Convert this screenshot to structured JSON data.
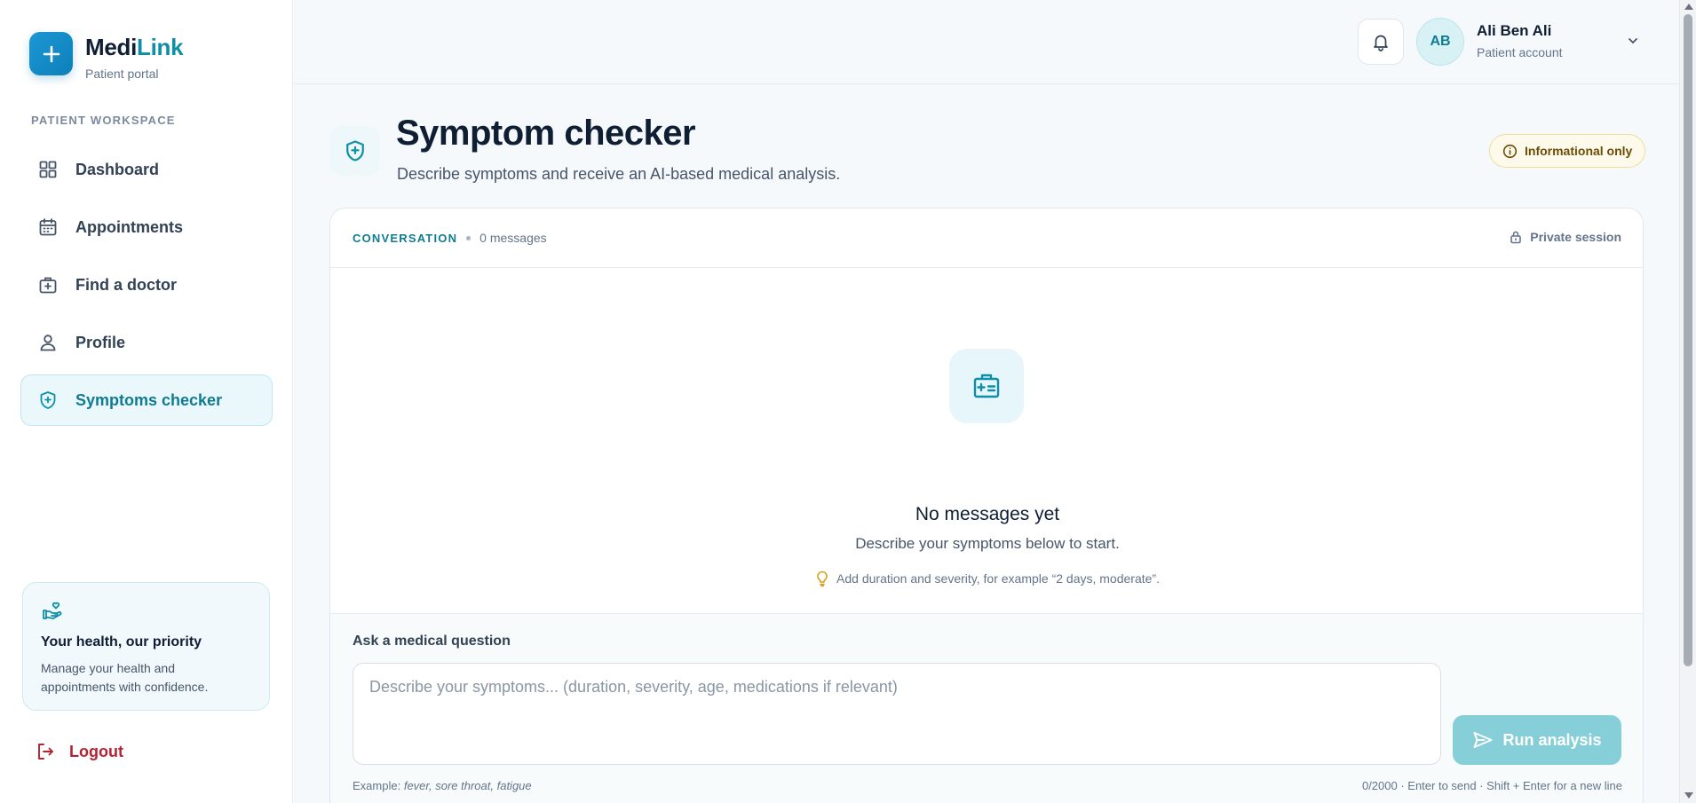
{
  "brand": {
    "name_part1": "Medi",
    "name_part2": "Link",
    "subtitle": "Patient portal"
  },
  "sidebar": {
    "section_label": "PATIENT WORKSPACE",
    "items": [
      {
        "label": "Dashboard",
        "icon": "grid-icon",
        "active": false
      },
      {
        "label": "Appointments",
        "icon": "calendar-icon",
        "active": false
      },
      {
        "label": "Find a doctor",
        "icon": "medical-bag-icon",
        "active": false
      },
      {
        "label": "Profile",
        "icon": "user-icon",
        "active": false
      },
      {
        "label": "Symptoms checker",
        "icon": "shield-plus-icon",
        "active": true
      }
    ],
    "promo": {
      "icon": "hand-heart-icon",
      "title": "Your health, our priority",
      "text": "Manage your health and appointments with confidence."
    },
    "logout_label": "Logout"
  },
  "topbar": {
    "user": {
      "initials": "AB",
      "name": "Ali Ben Ali",
      "role": "Patient account"
    }
  },
  "page": {
    "title": "Symptom checker",
    "subtitle": "Describe symptoms and receive an AI-based medical analysis.",
    "badge": "Informational only"
  },
  "conversation": {
    "label": "CONVERSATION",
    "count": "0 messages",
    "privacy": "Private session",
    "empty": {
      "title": "No messages yet",
      "subtitle": "Describe your symptoms below to start.",
      "tip": "Add duration and severity, for example “2 days, moderate”."
    }
  },
  "compose": {
    "label": "Ask a medical question",
    "placeholder": "Describe your symptoms... (duration, severity, age, medications if relevant)",
    "value": "",
    "button": "Run analysis",
    "example_prefix": "Example:",
    "example_value": "fever, sore throat, fatigue",
    "hint": "0/2000 · Enter to send · Shift + Enter for a new line"
  },
  "colors": {
    "accent": "#0e8fa8",
    "brand_blue": "#1b98d6",
    "danger": "#b42333",
    "badge_bg": "#fefaeb"
  }
}
